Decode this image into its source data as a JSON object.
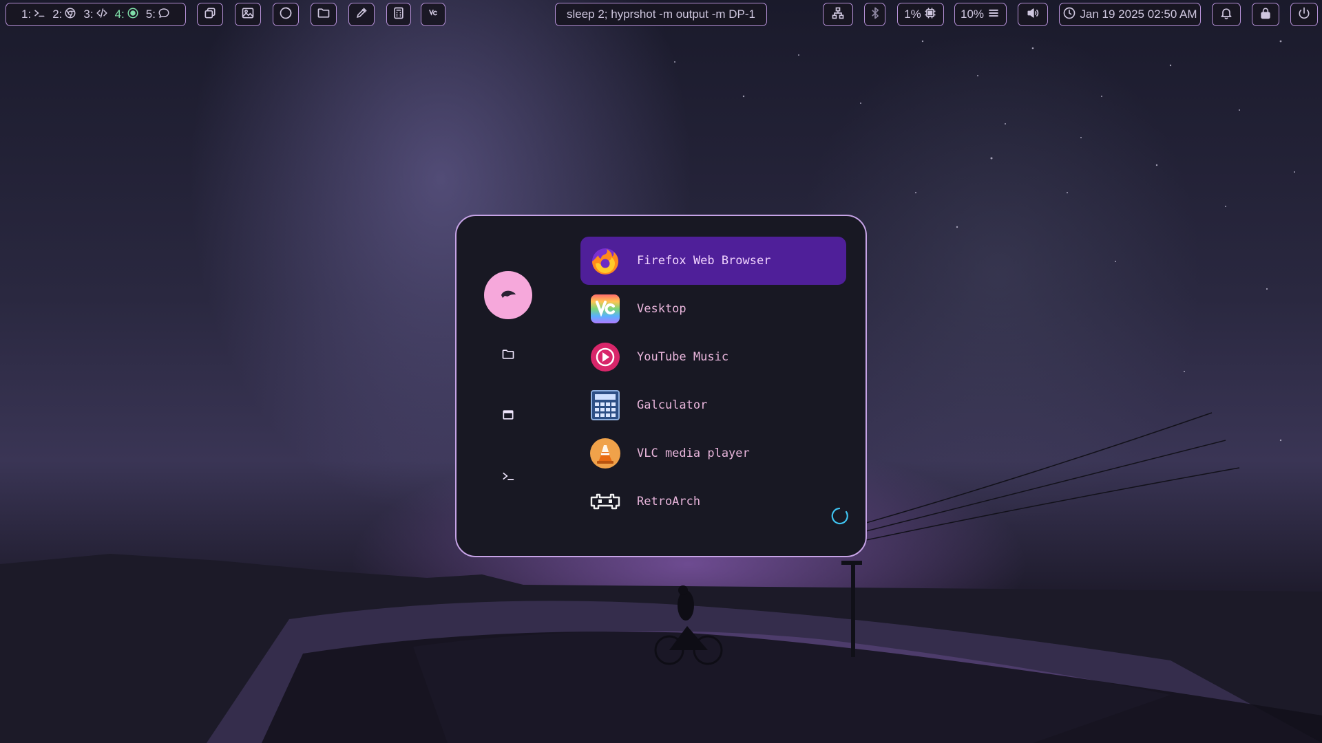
{
  "workspaces": [
    {
      "number": "1:",
      "icon": "terminal-icon",
      "active": false
    },
    {
      "number": "2:",
      "icon": "chrome-icon",
      "active": false
    },
    {
      "number": "3:",
      "icon": "code-icon",
      "active": false
    },
    {
      "number": "4:",
      "icon": "record-icon",
      "active": true
    },
    {
      "number": "5:",
      "icon": "chat-icon",
      "active": false
    }
  ],
  "quick_launch": [
    "windows-icon",
    "image-icon",
    "night-light-icon",
    "folder-icon",
    "color-picker-icon",
    "calculator-icon",
    "vesktop-icon"
  ],
  "command": "sleep 2; hyprshot -m output -m DP-1",
  "status": {
    "network_icon": "network-icon",
    "bluetooth_icon": "bluetooth-icon",
    "cpu": "1%",
    "memory": "10%",
    "volume_icon": "volume-icon",
    "clock": "Jan 19 2025 02:50 AM",
    "notification_icon": "bell-icon",
    "lock_icon": "lock-icon",
    "power_icon": "power-icon"
  },
  "launcher": {
    "sidebar": [
      "apps-mode-icon",
      "folder-icon",
      "window-icon",
      "terminal-icon"
    ],
    "apps": [
      {
        "label": "Firefox Web Browser",
        "icon": "firefox-icon",
        "selected": true
      },
      {
        "label": "Vesktop",
        "icon": "vesktop-icon",
        "selected": false
      },
      {
        "label": "YouTube Music",
        "icon": "youtube-music-icon",
        "selected": false
      },
      {
        "label": "Galculator",
        "icon": "galculator-icon",
        "selected": false
      },
      {
        "label": "VLC media player",
        "icon": "vlc-icon",
        "selected": false
      },
      {
        "label": "RetroArch",
        "icon": "retroarch-icon",
        "selected": false
      }
    ]
  },
  "colors": {
    "accent_border": "#b792d9",
    "selected_row": "#4f1f99",
    "label_pink": "#e9b6dc",
    "avatar_pink": "#f6a8db",
    "active_workspace": "#7fe0a9"
  }
}
